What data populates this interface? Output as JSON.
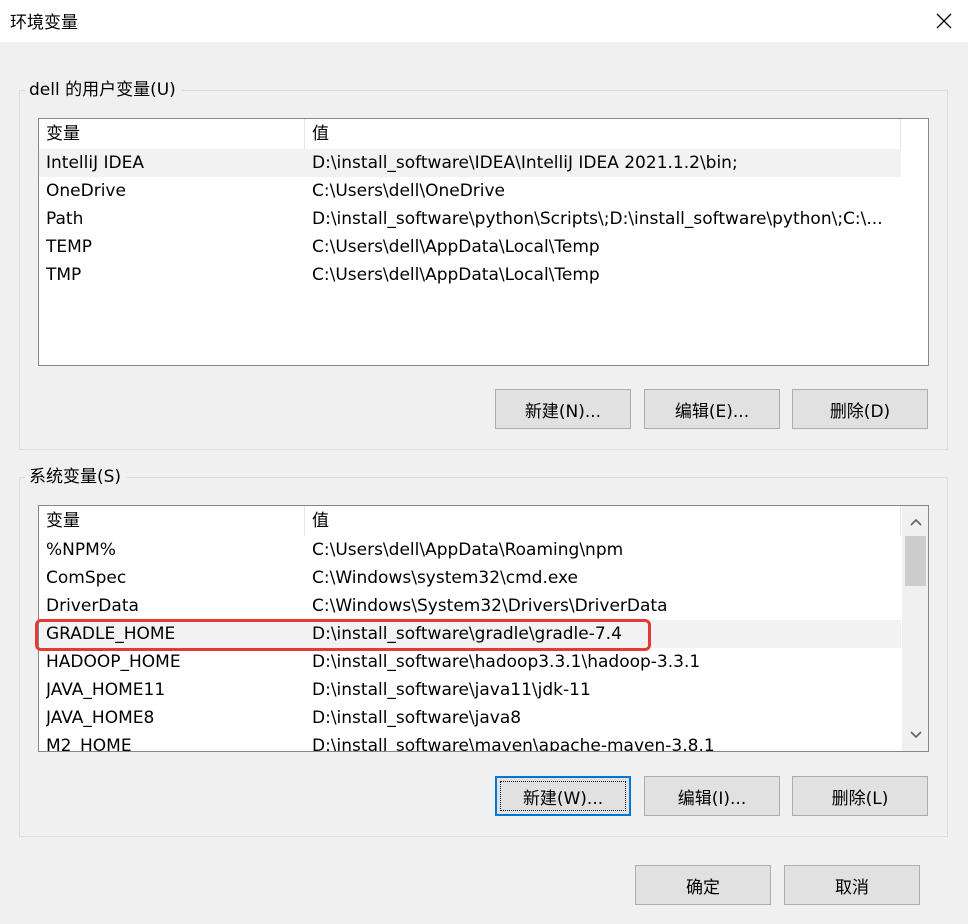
{
  "window": {
    "title": "环境变量"
  },
  "user_vars": {
    "group_label": "dell 的用户变量(U)",
    "columns": [
      "变量",
      "值"
    ],
    "rows": [
      {
        "name": "IntelliJ IDEA",
        "value": "D:\\install_software\\IDEA\\IntelliJ IDEA 2021.1.2\\bin;"
      },
      {
        "name": "OneDrive",
        "value": "C:\\Users\\dell\\OneDrive"
      },
      {
        "name": "Path",
        "value": "D:\\install_software\\python\\Scripts\\;D:\\install_software\\python\\;C:\\..."
      },
      {
        "name": "TEMP",
        "value": "C:\\Users\\dell\\AppData\\Local\\Temp"
      },
      {
        "name": "TMP",
        "value": "C:\\Users\\dell\\AppData\\Local\\Temp"
      }
    ],
    "buttons": {
      "new": "新建(N)...",
      "edit": "编辑(E)...",
      "delete": "删除(D)"
    }
  },
  "system_vars": {
    "group_label": "系统变量(S)",
    "columns": [
      "变量",
      "值"
    ],
    "rows": [
      {
        "name": "%NPM%",
        "value": "C:\\Users\\dell\\AppData\\Roaming\\npm"
      },
      {
        "name": "ComSpec",
        "value": "C:\\Windows\\system32\\cmd.exe"
      },
      {
        "name": "DriverData",
        "value": "C:\\Windows\\System32\\Drivers\\DriverData"
      },
      {
        "name": "GRADLE_HOME",
        "value": "D:\\install_software\\gradle\\gradle-7.4"
      },
      {
        "name": "HADOOP_HOME",
        "value": "D:\\install_software\\hadoop3.3.1\\hadoop-3.3.1"
      },
      {
        "name": "JAVA_HOME11",
        "value": "D:\\install_software\\java11\\jdk-11"
      },
      {
        "name": "JAVA_HOME8",
        "value": "D:\\install_software\\java8"
      },
      {
        "name": "M2_HOME",
        "value": "D:\\install_software\\maven\\apache-maven-3.8.1"
      }
    ],
    "buttons": {
      "new": "新建(W)...",
      "edit": "编辑(I)...",
      "delete": "删除(L)"
    }
  },
  "footer": {
    "ok": "确定",
    "cancel": "取消"
  },
  "colors": {
    "highlight": "#e53935",
    "selection": "#f2f2f2",
    "focus": "#0078d7"
  },
  "icons": {
    "close": "close-icon",
    "scroll_up": "chevron-up-icon",
    "scroll_down": "chevron-down-icon"
  }
}
